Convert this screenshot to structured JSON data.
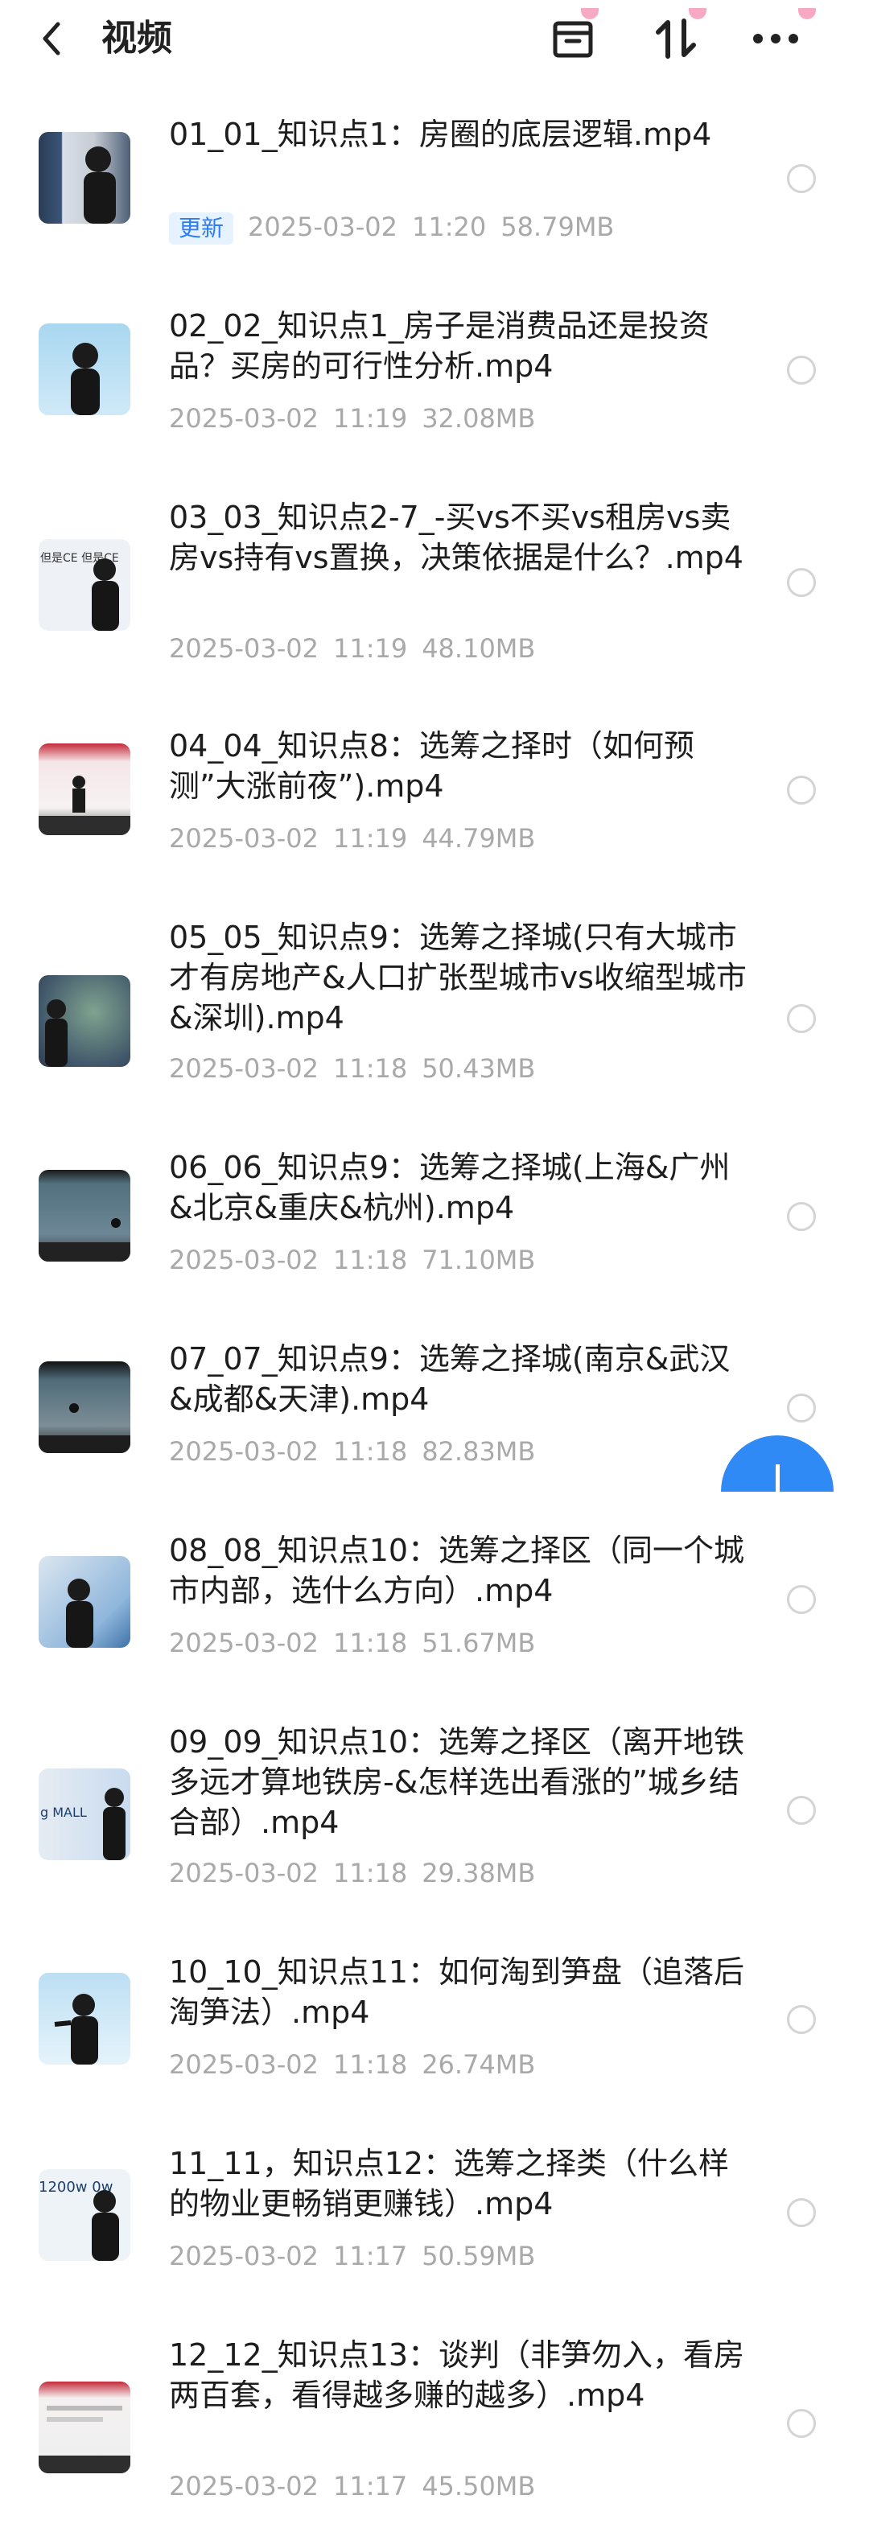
{
  "header": {
    "title": "视频",
    "back_icon": "chevron-left-icon",
    "archive_icon": "archive-box-icon",
    "sort_icon": "sort-arrows-icon",
    "more_icon": "more-dots-icon"
  },
  "colors": {
    "accent": "#2b7cf6",
    "badge_bg": "#e7f2ff",
    "meta": "#a9a9a9",
    "fab": "#2f8af5"
  },
  "items": [
    {
      "title": "01_01_知识点1：房圈的底层逻辑.mp4",
      "badge": "更新",
      "date": "2025-03-02",
      "time": "11:20",
      "size": "58.79MB"
    },
    {
      "title": "02_02_知识点1_房子是消费品还是投资品？买房的可行性分析.mp4",
      "date": "2025-03-02",
      "time": "11:19",
      "size": "32.08MB"
    },
    {
      "title": "03_03_知识点2-7_-买vs不买vs租房vs卖房vs持有vs置换，决策依据是什么？.mp4",
      "date": "2025-03-02",
      "time": "11:19",
      "size": "48.10MB"
    },
    {
      "title": "04_04_知识点8：选筹之择时（如何预测”大涨前夜”).mp4",
      "date": "2025-03-02",
      "time": "11:19",
      "size": "44.79MB"
    },
    {
      "title": "05_05_知识点9：选筹之择城(只有大城市才有房地产&人口扩张型城市vs收缩型城市&深圳).mp4",
      "date": "2025-03-02",
      "time": "11:18",
      "size": "50.43MB"
    },
    {
      "title": "06_06_知识点9：选筹之择城(上海&广州&北京&重庆&杭州).mp4",
      "date": "2025-03-02",
      "time": "11:18",
      "size": "71.10MB"
    },
    {
      "title": "07_07_知识点9：选筹之择城(南京&武汉&成都&天津).mp4",
      "date": "2025-03-02",
      "time": "11:18",
      "size": "82.83MB"
    },
    {
      "title": "08_08_知识点10：选筹之择区（同一个城市内部，选什么方向）.mp4",
      "date": "2025-03-02",
      "time": "11:18",
      "size": "51.67MB"
    },
    {
      "title": "09_09_知识点10：选筹之择区（离开地铁多远才算地铁房-&怎样选出看涨的”城乡结合部）.mp4",
      "date": "2025-03-02",
      "time": "11:18",
      "size": "29.38MB"
    },
    {
      "title": "10_10_知识点11：如何淘到笋盘（追落后淘笋法）.mp4",
      "date": "2025-03-02",
      "time": "11:18",
      "size": "26.74MB"
    },
    {
      "title": "11_11，知识点12：选筹之择类（什么样的物业更畅销更赚钱）.mp4",
      "date": "2025-03-02",
      "time": "11:17",
      "size": "50.59MB"
    },
    {
      "title": "12_12_知识点13：谈判（非笋勿入，看房两百套，看得越多赚的越多）.mp4",
      "date": "2025-03-02",
      "time": "11:17",
      "size": "45.50MB"
    }
  ],
  "thumb_texts": {
    "t3": "但是CE 但是CE",
    "t9": "g MALL",
    "t11": "1200w 0w"
  },
  "fab_icon": "plus-icon"
}
